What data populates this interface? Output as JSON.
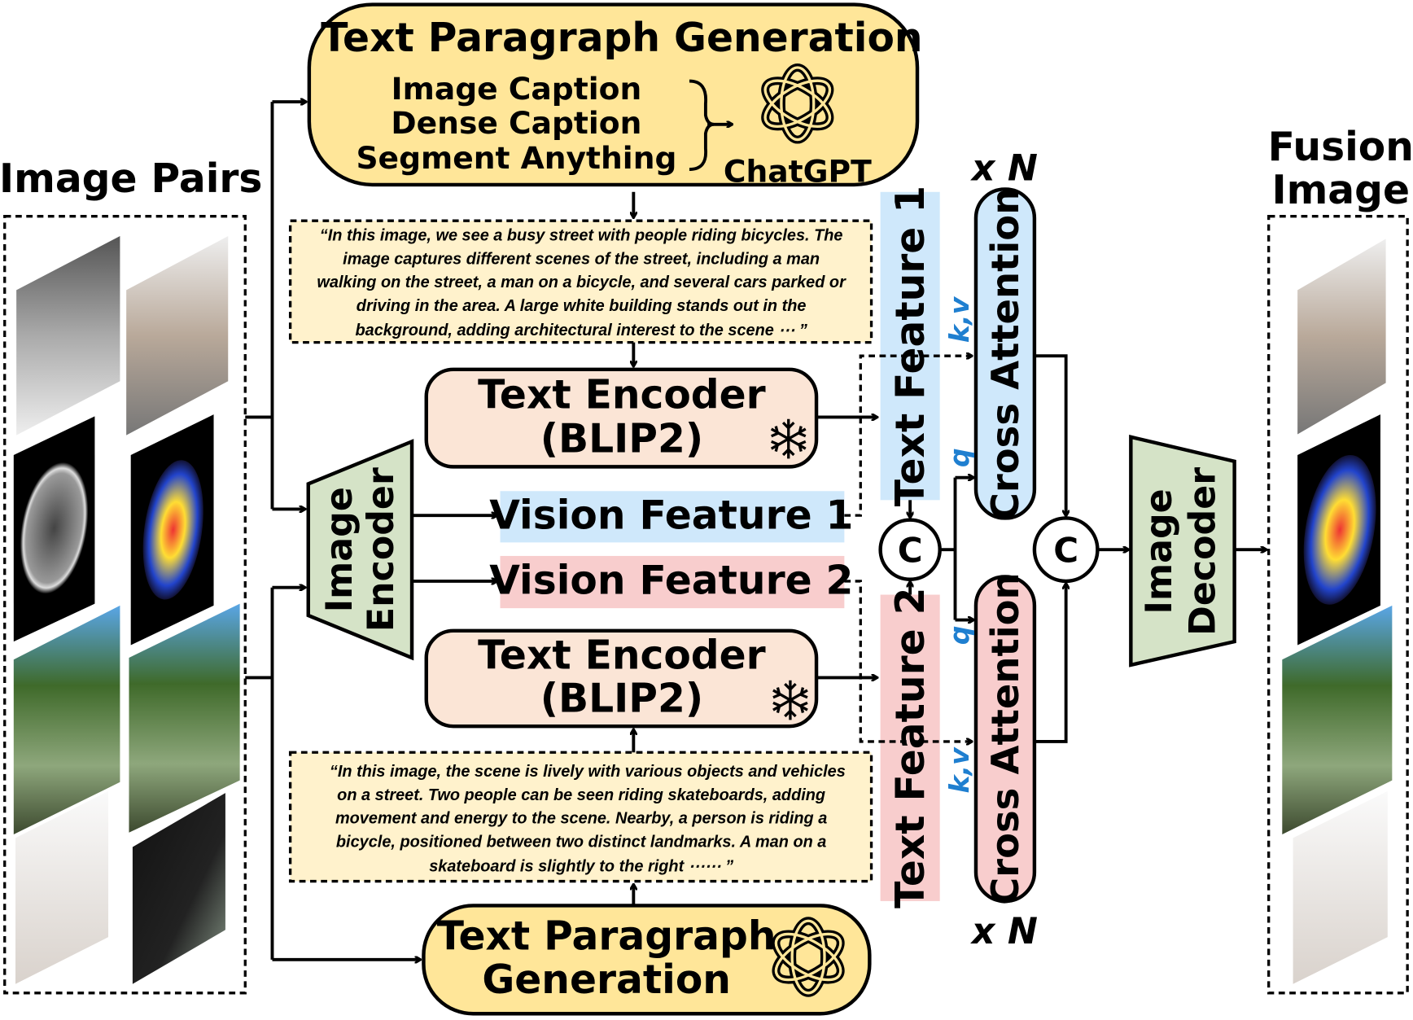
{
  "colors": {
    "yellow": "#FFE699",
    "peach": "#FBE5D6",
    "blue": "#CFE8FB",
    "pink": "#F8CDCD",
    "green": "#D5E3C7",
    "caption_bg": "#FFF2CC",
    "kv_q": "#1F7FD0"
  },
  "image_pairs_label": "Image Pairs",
  "fusion_label": [
    "Fusion",
    "Image"
  ],
  "top_generation": {
    "title": "Text Paragraph Generation",
    "sources": [
      "Image Caption",
      "Dense Caption",
      "Segment Anything"
    ],
    "model": "ChatGPT",
    "icon": "chatgpt-logo-icon"
  },
  "caption1": [
    "“In this image, we see a busy street with people riding bicycles. The",
    "image captures different scenes of the street, including a man",
    "walking on the street, a man on a bicycle, and several cars parked or",
    "driving in the area. A large white building stands out in the",
    "background, adding architectural interest to the scene ⋯ ”"
  ],
  "caption2": [
    "“In this image, the scene is lively with various objects and vehicles",
    "on a street. Two people can be seen riding skateboards, adding",
    "movement and energy to the scene. Nearby, a person is riding a",
    "bicycle, positioned between two distinct landmarks. A man on a",
    "skateboard is slightly to the right ⋯⋯ ”"
  ],
  "text_encoder": [
    "Text Encoder",
    "(BLIP2)"
  ],
  "frozen_icon": "snowflake-icon",
  "image_encoder": [
    "Image",
    "Encoder"
  ],
  "image_decoder": [
    "Image",
    "Decoder"
  ],
  "vision_feature_1": "Vision Feature 1",
  "vision_feature_2": "Vision Feature 2",
  "text_feature_1": "Text Feature 1",
  "text_feature_2": "Text Feature 2",
  "cross_attention": "Cross Attention",
  "repeat": "x N",
  "concat": "C",
  "kv": "k,v",
  "q": "q",
  "bottom_generation": [
    "Text Paragraph",
    "Generation"
  ]
}
